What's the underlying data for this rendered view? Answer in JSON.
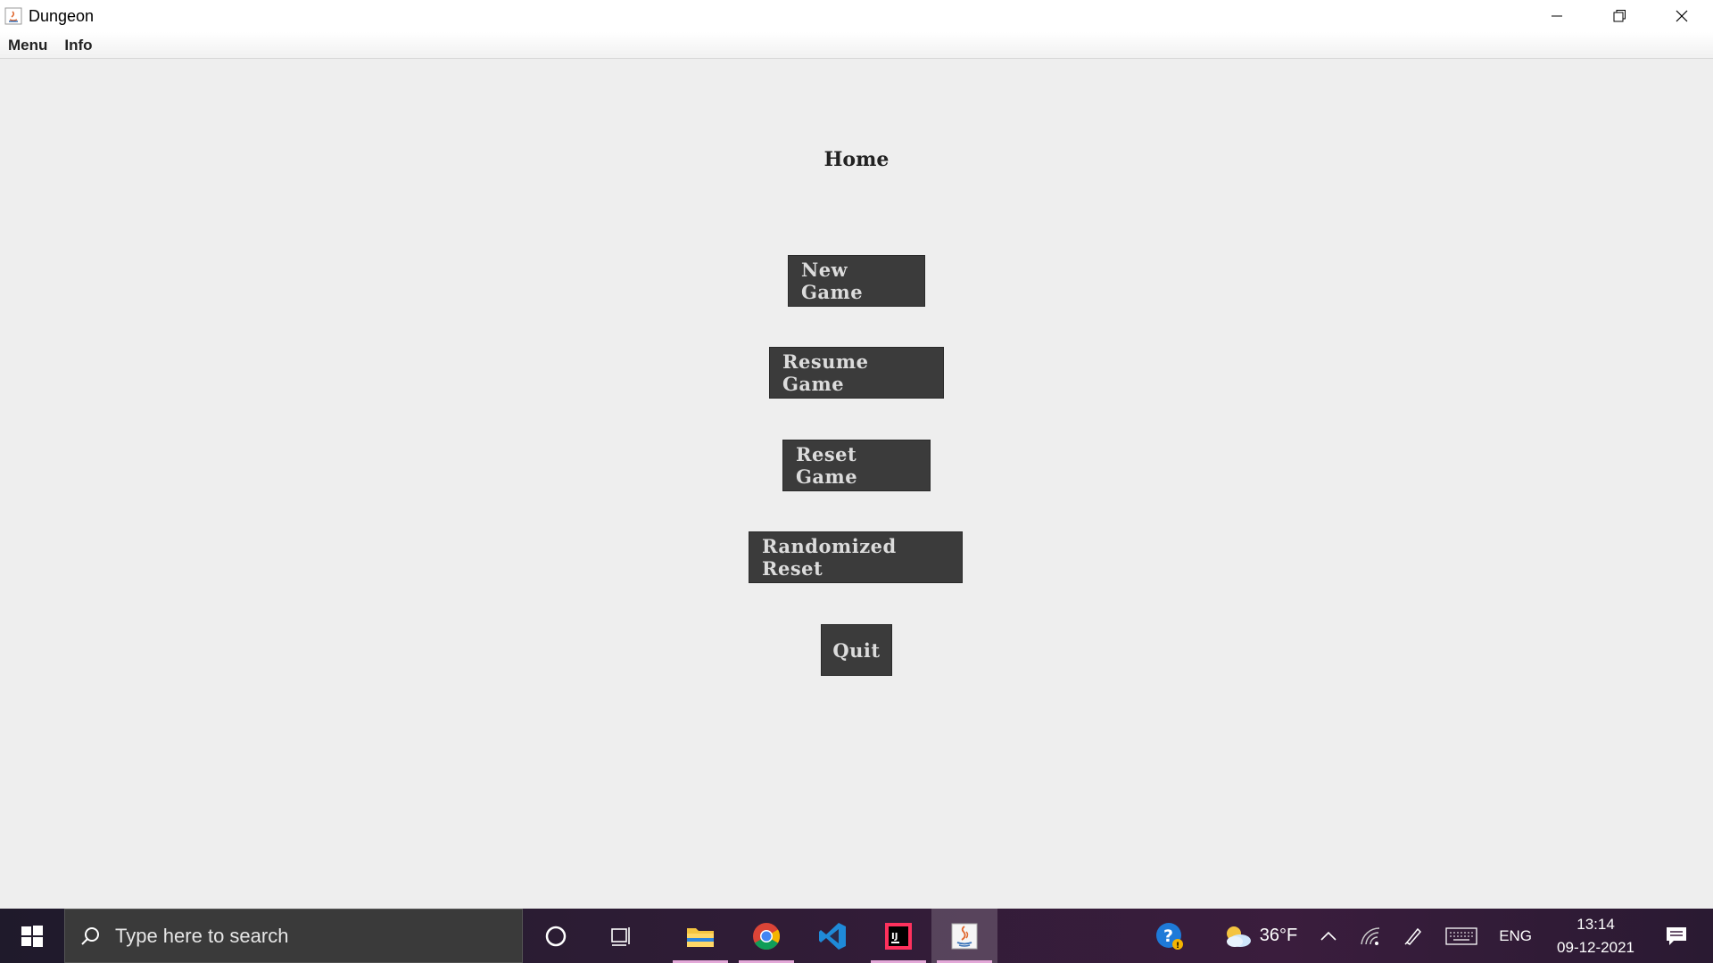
{
  "window": {
    "title": "Dungeon"
  },
  "menubar": {
    "items": [
      "Menu",
      "Info"
    ]
  },
  "home": {
    "title": "Home",
    "buttons": {
      "new_game": "New Game",
      "resume_game": "Resume Game",
      "reset_game": "Reset Game",
      "randomized_reset": "Randomized Reset",
      "quit": "Quit"
    }
  },
  "taskbar": {
    "search_placeholder": "Type here to search",
    "weather_temp": "36°F",
    "language": "ENG",
    "time": "13:14",
    "date": "09-12-2021",
    "apps": [
      "file-explorer-icon",
      "chrome-icon",
      "vscode-icon",
      "intellij-icon",
      "java-icon"
    ]
  },
  "colors": {
    "button_bg": "#3b3b3b",
    "button_text": "#dcdcdc",
    "content_bg": "#eeeeee",
    "taskbar_bg": "#2e1c35"
  }
}
